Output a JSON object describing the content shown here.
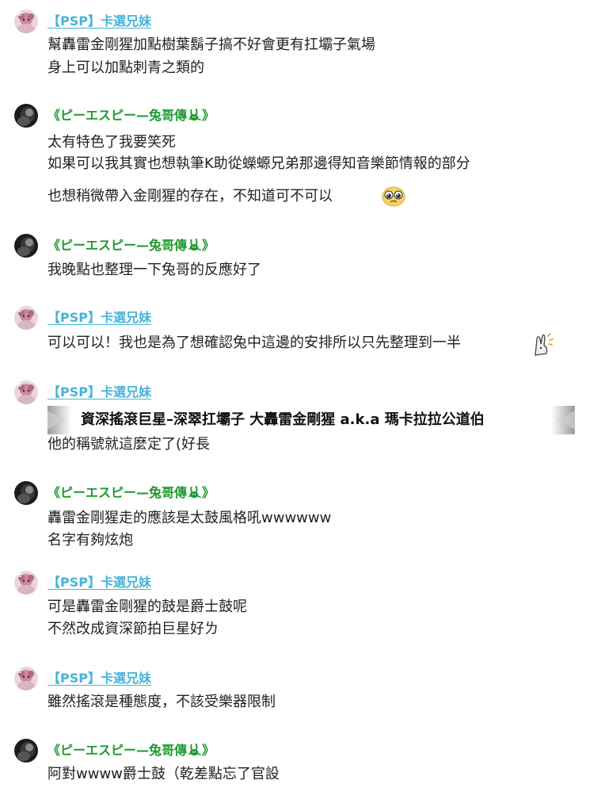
{
  "users": {
    "a": {
      "name": "【PSP】卡選兄妹"
    },
    "b": {
      "name": "《ピーエスピー—兔哥傳",
      "name_end": "》"
    }
  },
  "messages": [
    {
      "lines": [
        "幫轟雷金剛猩加點樹葉鬍子搞不好會更有扛壩子氣場",
        "身上可以加點刺青之類的"
      ]
    },
    {
      "lines": [
        "太有特色了我要笑死",
        "如果可以我其實也想執筆K助從蠑螈兄弟那邊得知音樂節情報的部分",
        "也想稍微帶入金剛猩的存在，不知道可不可以"
      ],
      "emoji": "pleading-face"
    },
    {
      "lines": [
        "我晚點也整理一下兔哥的反應好了"
      ]
    },
    {
      "lines": [
        "可以可以！我也是為了想確認兔中這邊的安排所以只先整理到一半"
      ],
      "emoji": "bunny-sticker"
    },
    {
      "banner": "資深搖滾巨星–深翠扛壩子 大轟雷金剛猩 a.k.a 瑪卡拉拉公道伯",
      "lines": [
        "他的稱號就這麼定了(好長"
      ]
    },
    {
      "lines": [
        "轟雷金剛猩走的應該是太鼓風格吼wwwwww",
        "名字有夠炫炮"
      ]
    },
    {
      "lines": [
        "可是轟雷金剛猩的鼓是爵士鼓呢",
        "不然改成資深節拍巨星好ㄌ"
      ]
    },
    {
      "lines": [
        "雖然搖滾是種態度，不該受樂器限制"
      ]
    },
    {
      "lines": [
        "阿對wwww爵士鼓（乾差點忘了官設"
      ]
    }
  ],
  "colors": {
    "name_a": "#48b4d8",
    "name_b": "#1f9a2e",
    "text": "#222222"
  }
}
